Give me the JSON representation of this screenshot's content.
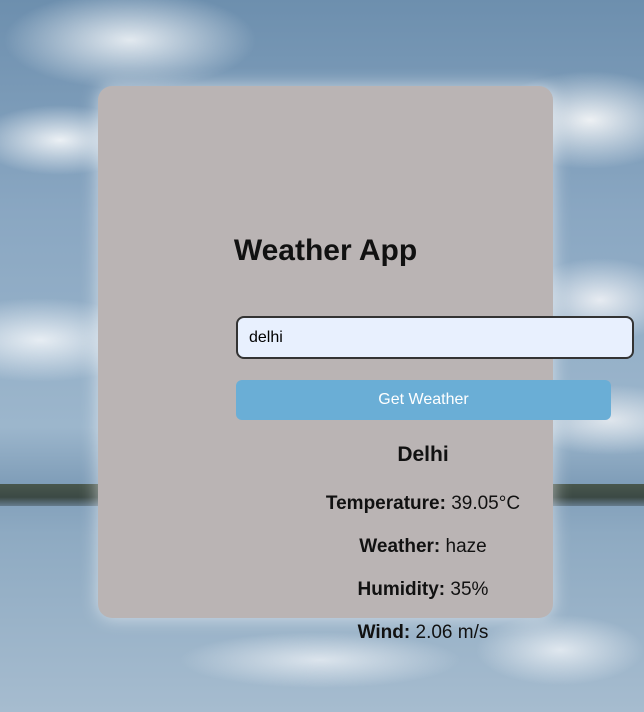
{
  "app": {
    "title": "Weather App"
  },
  "search": {
    "value": "delhi",
    "button_label": "Get Weather"
  },
  "result": {
    "city": "Delhi",
    "temperature_label": "Temperature:",
    "temperature_value": " 39.05°C",
    "weather_label": "Weather:",
    "weather_value": " haze",
    "humidity_label": "Humidity:",
    "humidity_value": " 35%",
    "wind_label": "Wind:",
    "wind_value": " 2.06 m/s"
  },
  "colors": {
    "card_background": "#bab4b4",
    "button_background": "#6aaed6",
    "input_background": "#e8f0fe"
  }
}
